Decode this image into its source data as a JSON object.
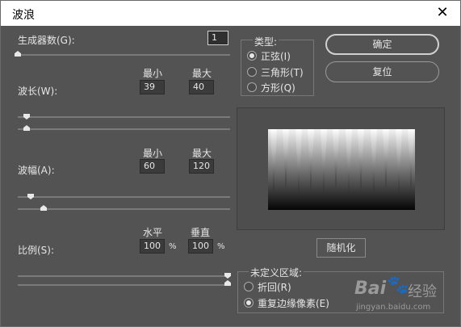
{
  "dialog": {
    "title": "波浪",
    "close_glyph": "✕"
  },
  "generators": {
    "label": "生成器数(G):",
    "value": "1"
  },
  "wavelength": {
    "label": "波长(W):",
    "min_label": "最小",
    "max_label": "最大",
    "min": "39",
    "max": "40"
  },
  "amplitude": {
    "label": "波幅(A):",
    "min_label": "最小",
    "max_label": "最大",
    "min": "60",
    "max": "120"
  },
  "scale": {
    "label": "比例(S):",
    "h_label": "水平",
    "v_label": "垂直",
    "h": "100",
    "v": "100",
    "unit": "%"
  },
  "type": {
    "legend": "类型:",
    "options": [
      {
        "label": "正弦(I)",
        "selected": true
      },
      {
        "label": "三角形(T)",
        "selected": false
      },
      {
        "label": "方形(Q)",
        "selected": false
      }
    ]
  },
  "buttons": {
    "ok": "确定",
    "reset": "复位",
    "randomize": "随机化"
  },
  "undefined_area": {
    "legend": "未定义区域:",
    "options": [
      {
        "label": "折回(R)",
        "selected": false
      },
      {
        "label": "重复边缘像素(E)",
        "selected": true
      }
    ]
  },
  "watermark": {
    "brand": "Bai",
    "brand2": "经验",
    "url": "jingyan.baidu.com"
  },
  "colors": {
    "panel": "#535353",
    "accent": "#e6e6e6"
  }
}
